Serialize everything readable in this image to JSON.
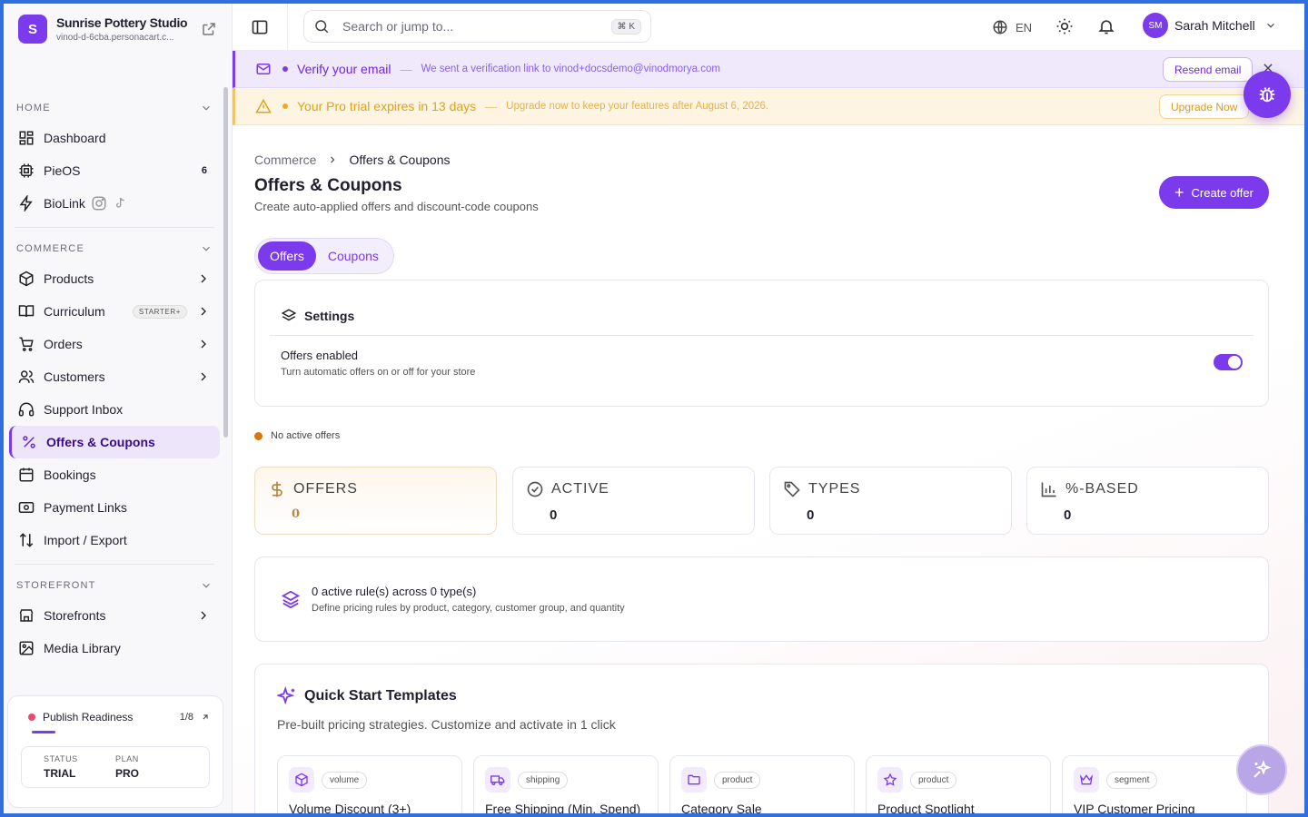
{
  "brand": {
    "initial": "S",
    "name": "Sunrise Pottery Studio",
    "url": "vinod-d-6cba.personacart.c..."
  },
  "sidebar": {
    "home": {
      "label": "HOME",
      "items": [
        {
          "label": "Dashboard",
          "icon": "dashboard-icon"
        },
        {
          "label": "PieOS",
          "icon": "chip-icon",
          "count": "6"
        },
        {
          "label": "BioLink",
          "icon": "bolt-icon"
        }
      ]
    },
    "commerce": {
      "label": "COMMERCE",
      "items": [
        {
          "label": "Products",
          "icon": "box-icon"
        },
        {
          "label": "Curriculum",
          "icon": "book-icon",
          "badge": "STARTER+"
        },
        {
          "label": "Orders",
          "icon": "cart-icon"
        },
        {
          "label": "Customers",
          "icon": "users-icon"
        },
        {
          "label": "Support Inbox",
          "icon": "headset-icon"
        },
        {
          "label": "Offers & Coupons",
          "icon": "percent-icon",
          "active": true
        },
        {
          "label": "Bookings",
          "icon": "calendar-icon"
        },
        {
          "label": "Payment Links",
          "icon": "payment-icon"
        },
        {
          "label": "Import / Export",
          "icon": "arrows-icon"
        }
      ]
    },
    "storefront": {
      "label": "STOREFRONT",
      "items": [
        {
          "label": "Storefronts",
          "icon": "store-icon"
        },
        {
          "label": "Media Library",
          "icon": "image-icon"
        }
      ]
    },
    "publish": {
      "title": "Publish Readiness",
      "count": "1/8",
      "progress": 0.125,
      "status_key": "STATUS",
      "status_val": "TRIAL",
      "plan_key": "PLAN",
      "plan_val": "PRO"
    }
  },
  "topbar": {
    "search_placeholder": "Search or jump to...",
    "shortcut": "⌘ K",
    "lang": "EN",
    "user_initials": "SM",
    "user_name": "Sarah Mitchell"
  },
  "banners": {
    "verify": {
      "title": "Verify your email",
      "dash": "—",
      "sub": "We sent a verification link to vinod+docsdemo@vinodmorya.com",
      "button": "Resend email",
      "color": "#7c3aed"
    },
    "trial": {
      "title": "Your Pro trial expires in 13 days",
      "dash": "—",
      "sub": "Upgrade now to keep your features after August 6, 2026.",
      "button": "Upgrade Now",
      "color": "#f5a623"
    }
  },
  "page": {
    "breadcrumb_parent": "Commerce",
    "breadcrumb_current": "Offers & Coupons",
    "title": "Offers & Coupons",
    "subtitle": "Create auto-applied offers and discount-code coupons",
    "create_button": "Create offer",
    "tabs": [
      "Offers",
      "Coupons"
    ]
  },
  "settings": {
    "title": "Settings",
    "offers_enabled_label": "Offers enabled",
    "offers_enabled_desc": "Turn automatic offers on or off for your store",
    "offers_enabled": true
  },
  "status_text": "No active offers",
  "stats": [
    {
      "label": "OFFERS",
      "value": "0",
      "icon": "dollar-icon"
    },
    {
      "label": "ACTIVE",
      "value": "0",
      "icon": "check-circle-icon"
    },
    {
      "label": "TYPES",
      "value": "0",
      "icon": "tag-icon"
    },
    {
      "label": "%-BASED",
      "value": "0",
      "icon": "bar-chart-icon"
    }
  ],
  "rules": {
    "title": "0 active rule(s) across 0 type(s)",
    "desc": "Define pricing rules by product, category, customer group, and quantity"
  },
  "quickstart": {
    "title": "Quick Start Templates",
    "subtitle": "Pre-built pricing strategies. Customize and activate in 1 click",
    "templates": [
      {
        "tag": "volume",
        "name": "Volume Discount (3+)",
        "icon": "box-icon"
      },
      {
        "tag": "shipping",
        "name": "Free Shipping (Min. Spend)",
        "icon": "truck-icon"
      },
      {
        "tag": "product",
        "name": "Category Sale",
        "icon": "folder-icon"
      },
      {
        "tag": "product",
        "name": "Product Spotlight",
        "icon": "star-icon"
      },
      {
        "tag": "segment",
        "name": "VIP Customer Pricing",
        "icon": "crown-icon"
      }
    ]
  }
}
